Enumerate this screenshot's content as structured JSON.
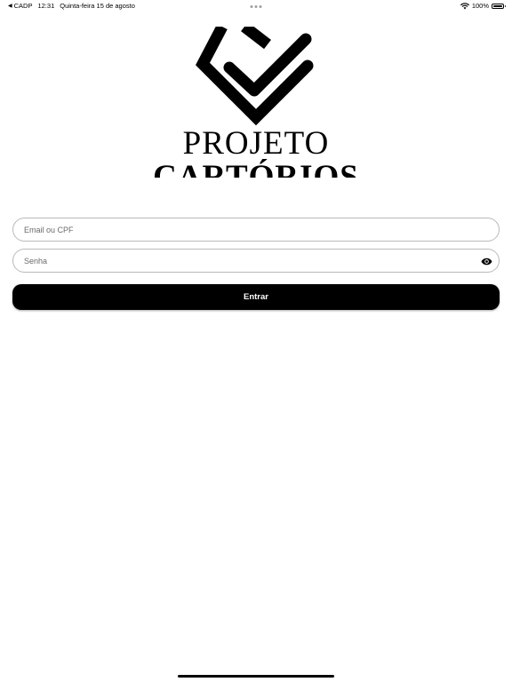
{
  "status_bar": {
    "back_app": "CADP",
    "time": "12:31",
    "date": "Quinta-feira 15 de agosto",
    "battery": "100%",
    "icons": [
      "back-arrow-icon",
      "multitasking-dots-icon",
      "wifi-icon",
      "battery-icon"
    ]
  },
  "logo": {
    "line1": "PROJETO",
    "line2": "CARTÓRIOS",
    "icon": "check-diamond-logo"
  },
  "form": {
    "email_placeholder": "Email ou CPF",
    "email_value": "",
    "password_placeholder": "Senha",
    "password_value": "",
    "password_toggle_icon": "eye-icon",
    "submit_label": "Entrar"
  },
  "colors": {
    "background": "#ffffff",
    "primary": "#000000",
    "input_border": "#b9b9b9",
    "placeholder": "#6b6b6b"
  }
}
